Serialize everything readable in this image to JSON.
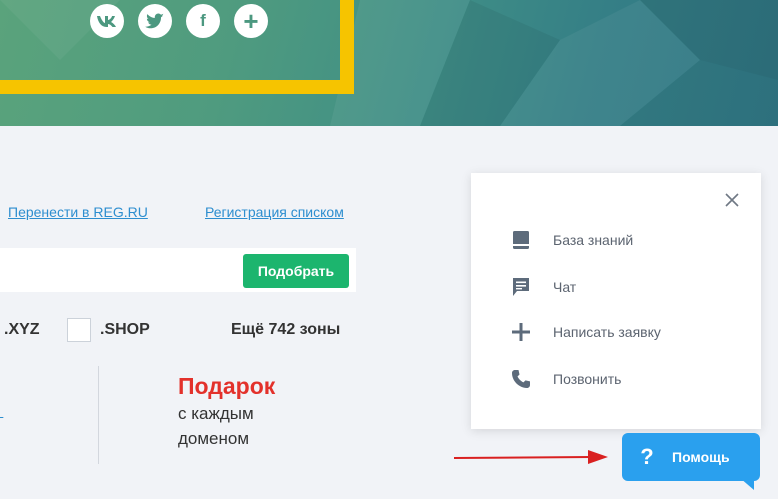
{
  "social": {
    "vk": "vk",
    "twitter": "twitter",
    "facebook": "f",
    "more": "+"
  },
  "links": {
    "transfer": "Перенести в REG.RU",
    "bulk": "Регистрация списком"
  },
  "search": {
    "button": "Подобрать"
  },
  "zones": {
    "xyz": ".XYZ",
    "shop": ".SHOP",
    "more": "Ещё 742 зоны"
  },
  "promo": {
    "title": "Подарок",
    "line1": "с каждым",
    "line2": "доменом"
  },
  "help_panel": {
    "items": [
      {
        "label": "База знаний",
        "icon": "book-icon"
      },
      {
        "label": "Чат",
        "icon": "chat-icon"
      },
      {
        "label": "Написать заявку",
        "icon": "plus-icon"
      },
      {
        "label": "Позвонить",
        "icon": "phone-icon"
      }
    ]
  },
  "help_button": {
    "icon": "?",
    "label": "Помощь"
  },
  "colors": {
    "accent": "#2aa0ee",
    "green": "#1cb56e",
    "red": "#e3312b",
    "yellow": "#f6c400"
  }
}
